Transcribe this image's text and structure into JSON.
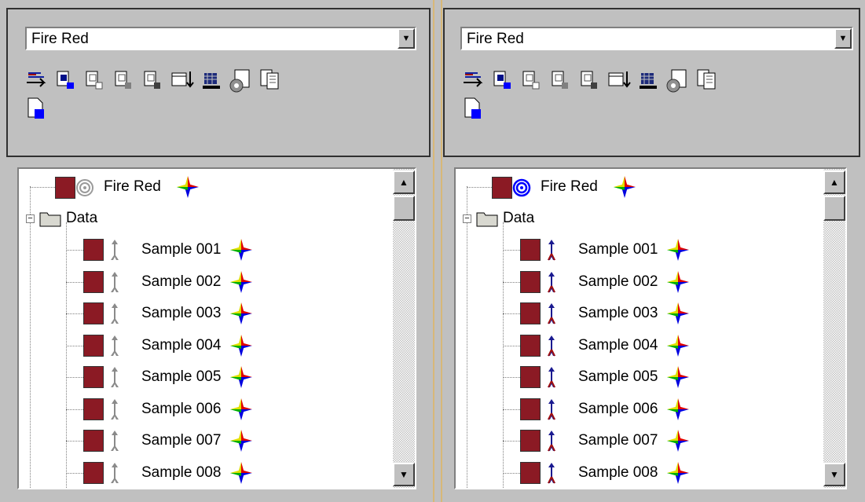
{
  "colors": {
    "swatch": "#8b1a24",
    "frame_border": "#d8b878"
  },
  "panes": [
    {
      "id": "left",
      "state": "inactive",
      "dropdown": {
        "selected": "Fire Red"
      },
      "toolbar_icons": [
        "project-tree-icon",
        "new-sample-icon",
        "open-sample-icon",
        "add-sample-icon",
        "remove-sample-icon",
        "import-date-icon",
        "spectrometer-icon",
        "gear-document-icon",
        "copy-document-icon",
        "new-page-icon"
      ],
      "tree": {
        "root_label": "Fire Red",
        "folder_label": "Data",
        "samples": [
          "Sample 001",
          "Sample 002",
          "Sample 003",
          "Sample 004",
          "Sample 005",
          "Sample 006",
          "Sample 007",
          "Sample 008"
        ]
      }
    },
    {
      "id": "right",
      "state": "active",
      "dropdown": {
        "selected": "Fire Red"
      },
      "toolbar_icons": [
        "project-tree-icon",
        "new-sample-icon",
        "open-sample-icon",
        "add-sample-icon",
        "remove-sample-icon",
        "import-date-icon",
        "spectrometer-icon",
        "gear-document-icon",
        "copy-document-icon",
        "new-page-icon"
      ],
      "tree": {
        "root_label": "Fire Red",
        "folder_label": "Data",
        "samples": [
          "Sample 001",
          "Sample 002",
          "Sample 003",
          "Sample 004",
          "Sample 005",
          "Sample 006",
          "Sample 007",
          "Sample 008"
        ]
      }
    }
  ]
}
